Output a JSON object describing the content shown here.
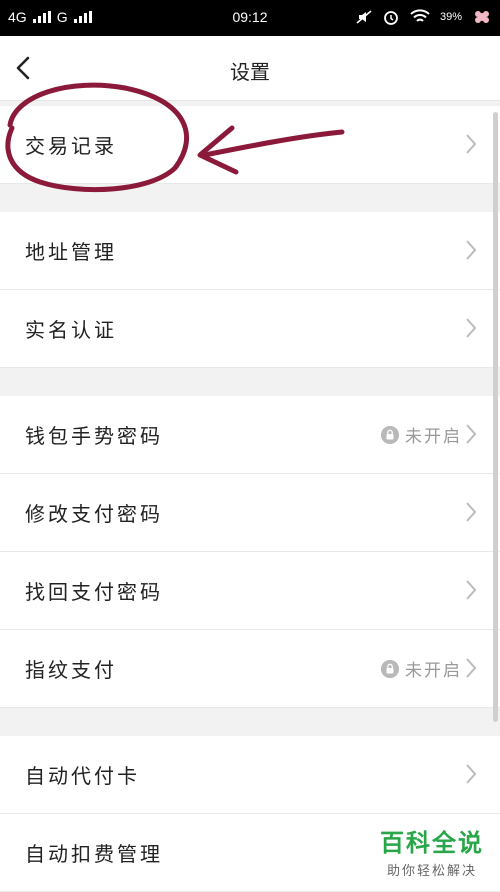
{
  "status_bar": {
    "network_1": "4G",
    "network_2": "G",
    "time": "09:12",
    "battery": "39%"
  },
  "header": {
    "title": "设置"
  },
  "menu": [
    {
      "label": "交易记录"
    },
    {
      "label": "地址管理"
    },
    {
      "label": "实名认证"
    },
    {
      "label": "钱包手势密码",
      "status": "未开启"
    },
    {
      "label": "修改支付密码"
    },
    {
      "label": "找回支付密码"
    },
    {
      "label": "指纹支付",
      "status": "未开启"
    },
    {
      "label": "自动代付卡"
    },
    {
      "label": "自动扣费管理"
    }
  ],
  "watermark": {
    "main": "百科全说",
    "sub": "助你轻松解决"
  },
  "colors": {
    "annotation": "#8b1a3a",
    "watermark": "#2aa64a"
  }
}
